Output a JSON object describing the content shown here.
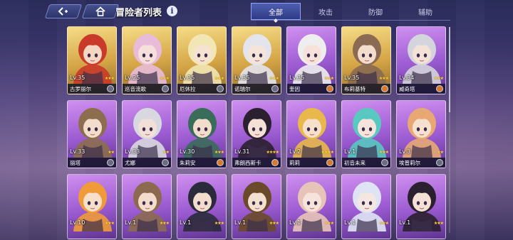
{
  "header": {
    "title": "冒险者列表",
    "info": "i"
  },
  "tabs": [
    {
      "label": "全部",
      "active": true
    },
    {
      "label": "攻击",
      "active": false
    },
    {
      "label": "防御",
      "active": false
    },
    {
      "label": "辅助",
      "active": false
    }
  ],
  "cards": [
    {
      "level": "Lv.35",
      "name": "古罗丽尔",
      "stars": 3,
      "rarity": "gold",
      "hair": "#c93a2a",
      "skin": "#f4d6c2",
      "badge": "grey"
    },
    {
      "level": "Lv.25",
      "name": "巡音流歌",
      "stars": 3,
      "rarity": "gold",
      "hair": "#e8bcd8",
      "skin": "#f6e0dc",
      "badge": "grey"
    },
    {
      "level": "Lv.35",
      "name": "厄休拉",
      "stars": 3,
      "rarity": "gold",
      "hair": "#f2e6b4",
      "skin": "#f6e2d0",
      "badge": "grey"
    },
    {
      "level": "Lv.35",
      "name": "诺瑞尔",
      "stars": 3,
      "rarity": "gold",
      "hair": "#e4e4ec",
      "skin": "#f4e4da",
      "badge": "grey"
    },
    {
      "level": "Lv.35",
      "name": "奎因",
      "stars": 3,
      "rarity": "purple",
      "hair": "#eeeeee",
      "skin": "#f6e2da",
      "badge": "orange"
    },
    {
      "level": "Lv.35",
      "name": "布莉基特",
      "stars": 3,
      "rarity": "gold",
      "hair": "#8a6a52",
      "skin": "#f4dccc",
      "badge": "orange"
    },
    {
      "level": "Lv.34",
      "name": "威奇塔",
      "stars": 3,
      "rarity": "purple",
      "hair": "#d4d4dc",
      "skin": "#f4e2d8",
      "badge": "orange"
    },
    {
      "level": "Lv.33",
      "name": "丽塔",
      "stars": 2,
      "rarity": "purple",
      "hair": "#8c6e4e",
      "skin": "#f4dccc",
      "badge": "grey"
    },
    {
      "level": "Lv.33",
      "name": "尤娜",
      "stars": 2,
      "rarity": "purple",
      "hair": "#d8d8e0",
      "skin": "#f2e0d8",
      "badge": "grey"
    },
    {
      "level": "Lv.30",
      "name": "朱莉安",
      "stars": 3,
      "rarity": "purple",
      "hair": "#3a6c5a",
      "skin": "#f2dccc",
      "badge": "orange"
    },
    {
      "level": "Lv.31",
      "name": "弗朗西斯卡",
      "stars": 4,
      "rarity": "purple",
      "hair": "#2a2030",
      "skin": "#f4e0d4",
      "badge": "orange"
    },
    {
      "level": "Lv.2",
      "name": "莉莉",
      "stars": 4,
      "rarity": "purple",
      "hair": "#e8b84a",
      "skin": "#f6e0cc",
      "badge": "orange"
    },
    {
      "level": "Lv.1",
      "name": "初音未来",
      "stars": 3,
      "rarity": "purple",
      "hair": "#58c8c0",
      "skin": "#f6e4dc",
      "badge": "grey"
    },
    {
      "level": "Lv.3",
      "name": "埃普莉尔",
      "stars": 2,
      "rarity": "purple",
      "hair": "#e8a874",
      "skin": "#f6e0d0",
      "badge": "grey"
    },
    {
      "level": "Lv.10",
      "name": "",
      "stars": 3,
      "rarity": "purple",
      "hair": "#f09a3a",
      "skin": "#f6e0cc",
      "badge": "none"
    },
    {
      "level": "Lv.1",
      "name": "",
      "stars": 3,
      "rarity": "purple",
      "hair": "#8c6a50",
      "skin": "#f4dccc",
      "badge": "none"
    },
    {
      "level": "Lv.1",
      "name": "",
      "stars": 3,
      "rarity": "purple",
      "hair": "#2a2a3a",
      "skin": "#f2dccc",
      "badge": "none"
    },
    {
      "level": "Lv.1",
      "name": "",
      "stars": 3,
      "rarity": "purple",
      "hair": "#6a4a2a",
      "skin": "#f4e0d0",
      "badge": "none"
    },
    {
      "level": "Lv.1",
      "name": "",
      "stars": 3,
      "rarity": "purple",
      "hair": "#e8c4b8",
      "skin": "#f6e4dc",
      "badge": "none"
    },
    {
      "level": "Lv.1",
      "name": "",
      "stars": 3,
      "rarity": "purple",
      "hair": "#dfe4f4",
      "skin": "#f6e6e0",
      "badge": "none"
    },
    {
      "level": "Lv.1",
      "name": "",
      "stars": 3,
      "rarity": "purple",
      "hair": "#2a2030",
      "skin": "#f4e0d4",
      "badge": "none"
    }
  ]
}
